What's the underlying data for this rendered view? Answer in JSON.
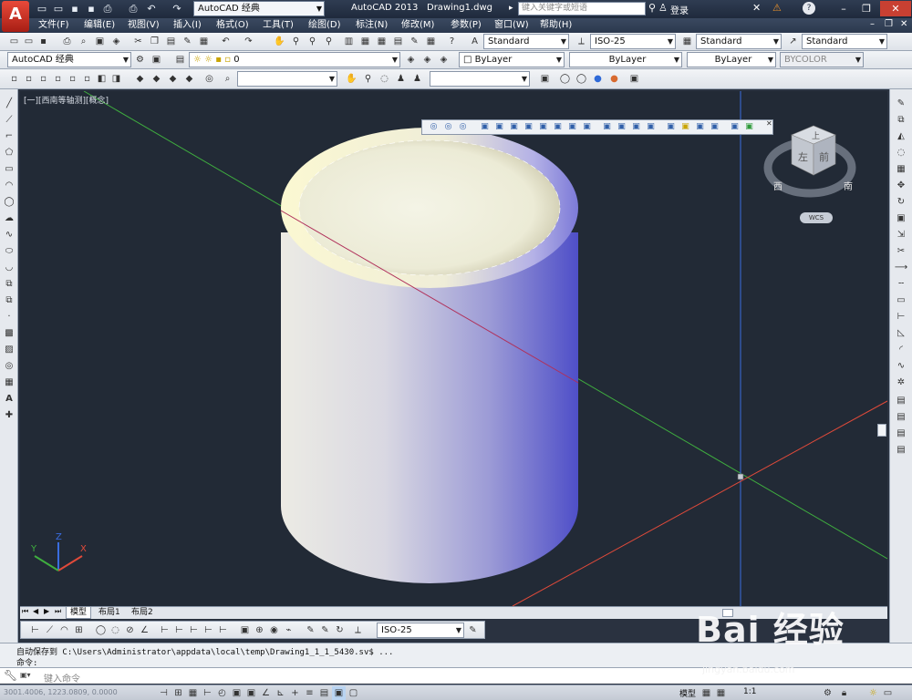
{
  "titlebar": {
    "logo": "A",
    "workspace": "AutoCAD 经典",
    "app": "AutoCAD 2013",
    "doc": "Drawing1.dwg",
    "search_placeholder": "键入关键字或短语",
    "login": "登录",
    "help": "?"
  },
  "menus": [
    "文件(F)",
    "编辑(E)",
    "视图(V)",
    "插入(I)",
    "格式(O)",
    "工具(T)",
    "绘图(D)",
    "标注(N)",
    "修改(M)",
    "参数(P)",
    "窗口(W)",
    "帮助(H)"
  ],
  "toolbar1": {
    "text_style": "Standard",
    "dim_style": "ISO-25",
    "table_style": "Standard",
    "mleader_style": "Standard"
  },
  "toolbar2": {
    "workspace": "AutoCAD 经典",
    "layer": "0",
    "color": "ByLayer",
    "linetype": "ByLayer",
    "lineweight": "ByLayer",
    "plotstyle": "BYCOLOR"
  },
  "viewport": {
    "label": "[一][西南等轴测][概念]",
    "wcs": "WCS",
    "viewcube_top": "上",
    "viewcube_left": "左",
    "viewcube_front": "前",
    "compass_w": "西",
    "compass_s": "南"
  },
  "ucs": {
    "x": "X",
    "y": "Y",
    "z": "Z"
  },
  "tabs": [
    "模型",
    "布局1",
    "布局2"
  ],
  "dimbar": {
    "dim_style": "ISO-25"
  },
  "command": {
    "history": "自动保存到 C:\\Users\\Administrator\\appdata\\local\\temp\\Drawing1_1_1_5430.sv$ ...",
    "prompt": "命令:",
    "input_placeholder": "键入命令"
  },
  "status": {
    "coords": "3001.4006, 1223.0809, 0.0000",
    "model": "模型",
    "scale": "1:1"
  },
  "watermark": {
    "brand": "Bai  经验",
    "url": "jingyan.baidu.com"
  },
  "colors": {
    "x_axis": "#e04a3a",
    "y_axis": "#3fae3f",
    "z_axis": "#3a6de0",
    "background": "#222a36"
  }
}
